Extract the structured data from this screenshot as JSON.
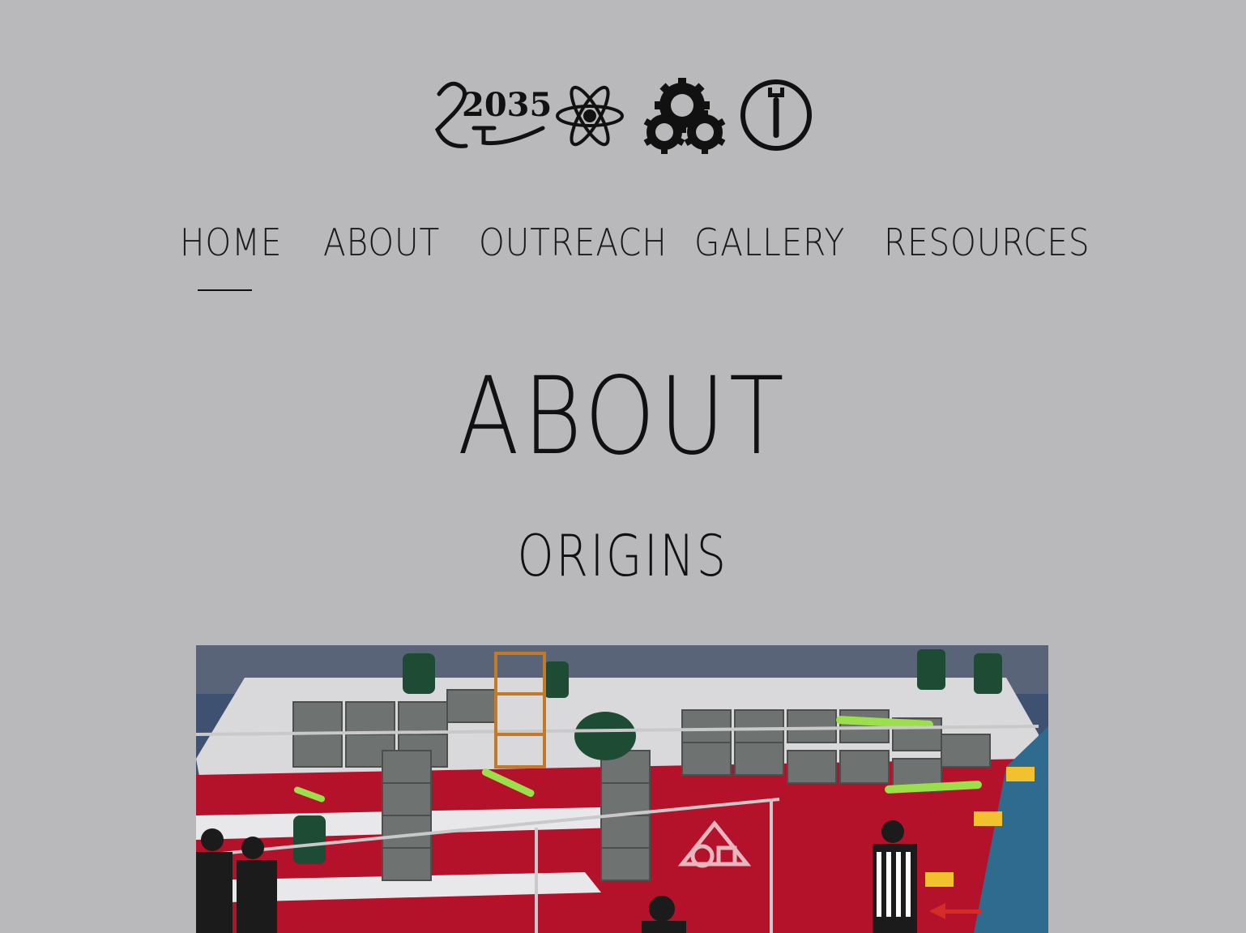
{
  "logo": {
    "icons": [
      "team-2035-glyph-icon",
      "atom-icon",
      "gears-icon",
      "wrench-circle-icon"
    ],
    "number_text": "2035"
  },
  "nav": {
    "items": [
      {
        "label": "HOME",
        "active": true
      },
      {
        "label": "ABOUT",
        "active": false
      },
      {
        "label": "OUTREACH",
        "active": false
      },
      {
        "label": "GALLERY",
        "active": false
      },
      {
        "label": "RESOURCES",
        "active": false
      }
    ]
  },
  "main": {
    "title": "ABOUT",
    "section_title": "ORIGINS"
  },
  "colors": {
    "background": "#b9b9bb",
    "text": "#111111"
  }
}
